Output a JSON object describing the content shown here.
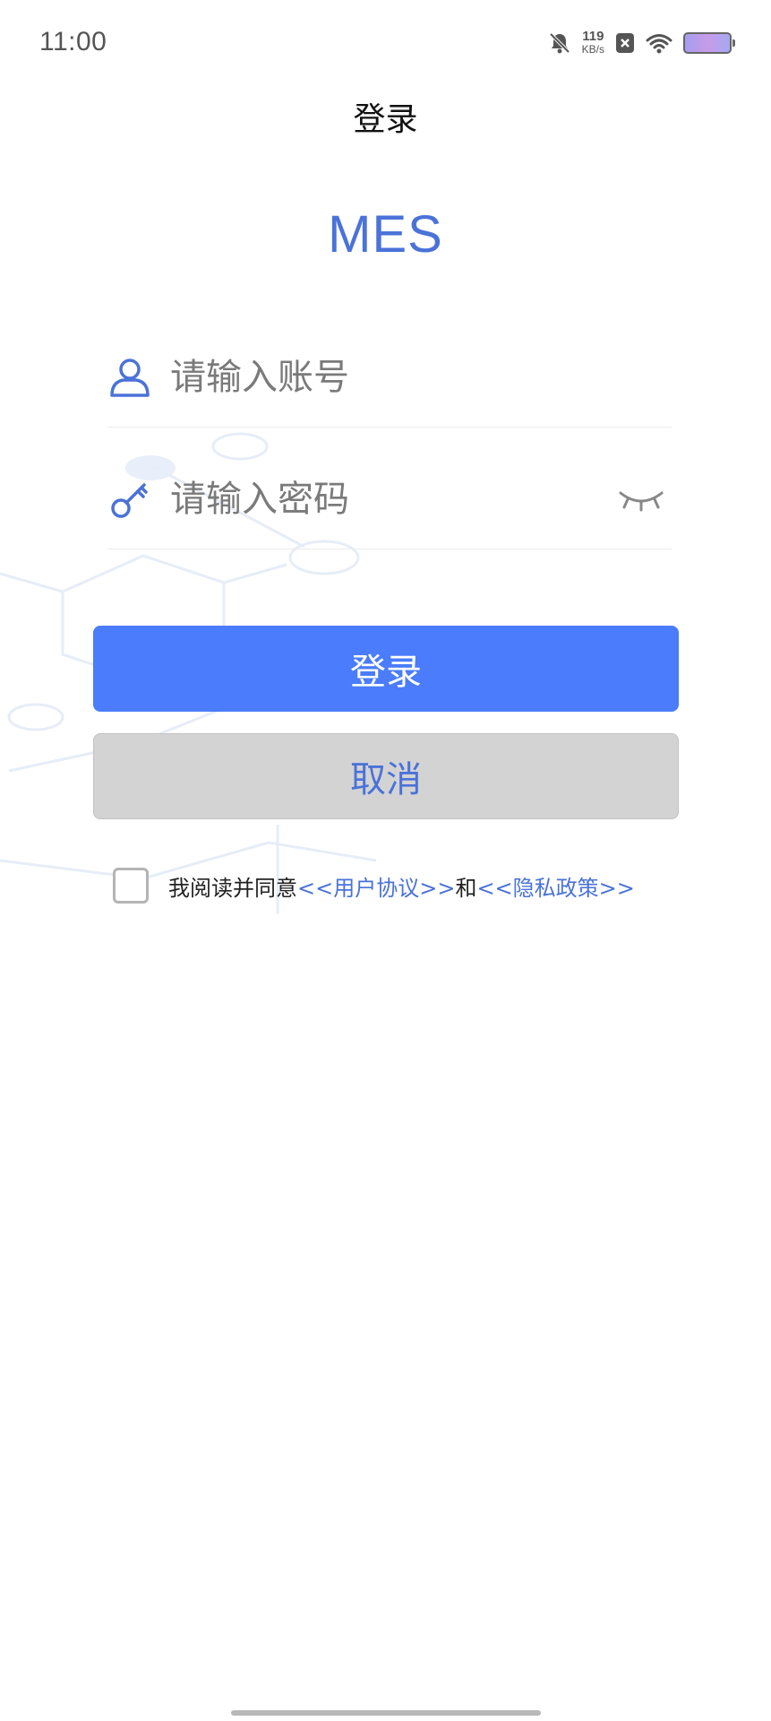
{
  "status_bar": {
    "time": "11:00",
    "net_speed_value": "119",
    "net_speed_unit": "KB/s",
    "icons": [
      "bell-muted-icon",
      "sim-disabled-icon",
      "wifi-icon",
      "battery-icon"
    ]
  },
  "nav": {
    "title": "登录"
  },
  "app": {
    "name": "MES",
    "accent_color": "#4a72d8"
  },
  "form": {
    "account_placeholder": "请输入账号",
    "account_value": "",
    "password_placeholder": "请输入密码",
    "password_value": "",
    "login_label": "登录",
    "cancel_label": "取消",
    "login_color": "#4a7cfc",
    "cancel_color": "#d3d3d3"
  },
  "agreement": {
    "checked": false,
    "prefix": "我阅读并同意",
    "user_agreement": "<<用户协议>>",
    "and": "和",
    "privacy_policy": "<<隐私政策>>"
  }
}
